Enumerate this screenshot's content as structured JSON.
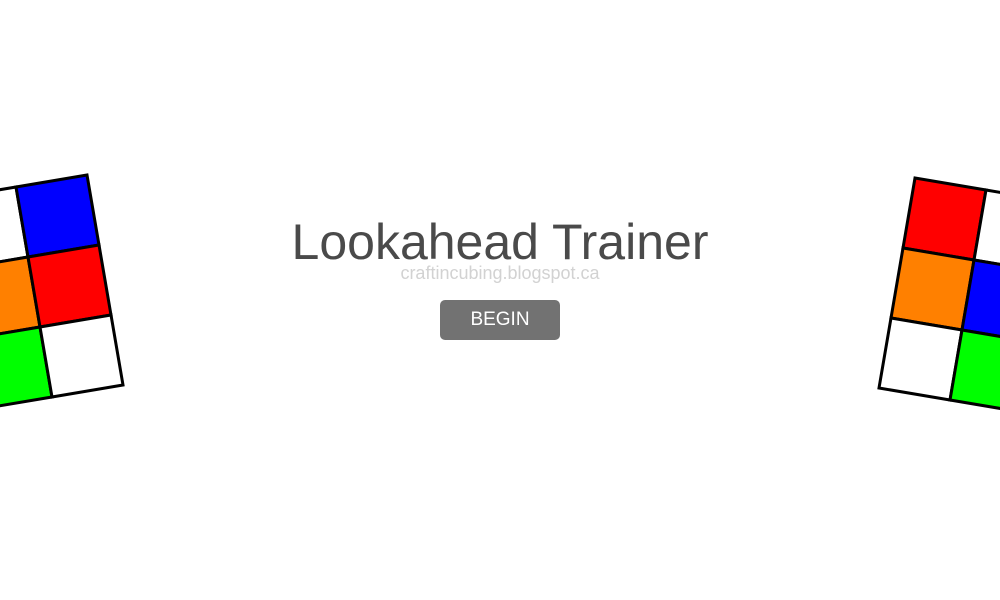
{
  "title": "Lookahead Trainer",
  "subtitle": "craftincubing.blogspot.ca",
  "begin_label": "BEGIN",
  "colors": {
    "title": "#4a4a4a",
    "subtitle": "#d2d2d2",
    "button_bg": "#727272",
    "button_text": "#ffffff",
    "sticker_border": "#000000"
  },
  "left_cube": {
    "stickers": [
      [
        "#ffffff",
        "#0000ff"
      ],
      [
        "#ff8000",
        "#ff0000"
      ],
      [
        "#00ff00",
        "#ffffff"
      ]
    ]
  },
  "right_cube": {
    "stickers": [
      [
        "#ff0000",
        "#ffffff"
      ],
      [
        "#ff8000",
        "#0000ff"
      ],
      [
        "#ffffff",
        "#00ff00"
      ]
    ]
  }
}
